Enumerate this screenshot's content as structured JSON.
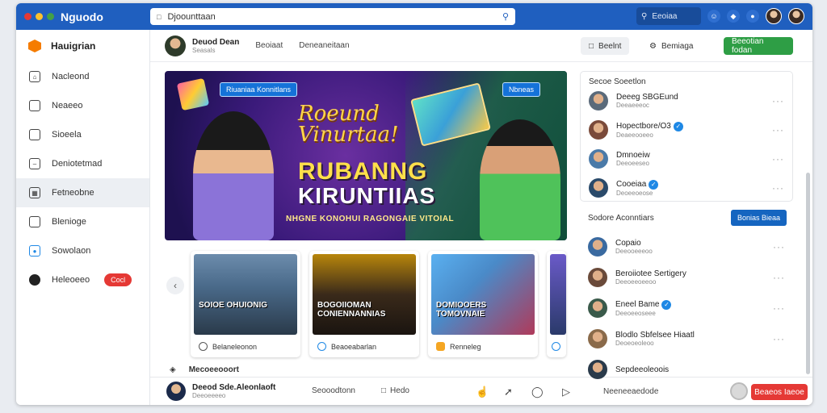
{
  "window": {
    "dots": [
      "#e53935",
      "#fbc02d",
      "#43a047"
    ],
    "brand": "Nguodo",
    "search_placeholder": "Djoounttaan"
  },
  "topbar": {
    "search_label": "Eeoiaa",
    "accent": "#1f5fbf"
  },
  "sidebar": {
    "brand": "Hauigrian",
    "items": [
      {
        "label": "Nacleond",
        "icon": "home-icon"
      },
      {
        "label": "Neaeeo",
        "icon": "bookmark-icon"
      },
      {
        "label": "Sioeela",
        "icon": "square-icon"
      },
      {
        "label": "Deniotetmad",
        "icon": "document-icon"
      },
      {
        "label": "Fetneobne",
        "icon": "grid-icon",
        "active": true
      },
      {
        "label": "Blenioge",
        "icon": "folder-icon"
      },
      {
        "label": "Sowolaon",
        "icon": "camera-icon"
      },
      {
        "label": "Heleoeeo",
        "icon": "user-icon",
        "badge": "Cocl"
      }
    ]
  },
  "header": {
    "user_name": "Deuod Dean",
    "user_sub": "Seasals",
    "tabs": [
      "Beoiaat",
      "Deneaneitaan"
    ],
    "buttons": {
      "feedback": "Beelnt",
      "settings": "Bemiaga",
      "primary": "Beeotian fodan"
    }
  },
  "banner": {
    "tag_left": "Riuaniaa Konnitlans",
    "tag_right": "Nbneas",
    "script": "Roeund Vinurtaa!",
    "title1": "RUBANNG",
    "title2": "KIRUNTIIAS",
    "subtitle": "NHGNE KONOHUI RAGONGAIE VITOIAL"
  },
  "carousel": {
    "cards": [
      {
        "caption": "SOIOE OHUIONIG",
        "footer": "Belaneleonon",
        "bg": "#4a6a8a"
      },
      {
        "caption": "BOGOIIOMAN CONIENNANNIAS",
        "footer": "Beaoeabarlan",
        "bg": "#3a2a1a"
      },
      {
        "caption": "DOMIOOERS TOMOVNAIE",
        "footer": "Renneleg",
        "bg": "#4a8ac8"
      }
    ]
  },
  "section": {
    "label": "Mecoeeooort",
    "icon": "compass-icon"
  },
  "bottombar": {
    "user_name": "Deeod Sde.Aleonlaoft",
    "user_sub": "Deeoeeeeo",
    "tab": "Seooodtonn",
    "icon_label": "Hedo",
    "status": "Neeneeaedode",
    "button": "Beaeos Iaeoe"
  },
  "right_panel": {
    "title": "Secoe Soeetlon",
    "rows": [
      {
        "name": "Deeeg SBGEund",
        "sub": "Deeaeeeoc",
        "verified": false,
        "bg": "#5a6a7a"
      },
      {
        "name": "Hopectbore/O3",
        "sub": "Deaeeooeeo",
        "verified": true,
        "bg": "#7a4a3a"
      },
      {
        "name": "Dmnoeiw",
        "sub": "Deeoeeseo",
        "verified": false,
        "bg": "#4a7aa8"
      },
      {
        "name": "Cooeiaa",
        "sub": "Deoeeoeose",
        "verified": true,
        "bg": "#2a4a6a"
      }
    ]
  },
  "right_panel2": {
    "title": "Sodore Aconntiars",
    "button": "Bonias Bieaa",
    "rows": [
      {
        "name": "Copaio",
        "sub": "Deeooeeeoo",
        "verified": false,
        "bg": "#3a6aa0"
      },
      {
        "name": "Beroiiotee Sertigery",
        "sub": "Deeoeeoeeoo",
        "verified": false,
        "bg": "#6a4a3a"
      },
      {
        "name": "Eneel Bame",
        "sub": "Deeoeeoseee",
        "verified": true,
        "bg": "#3a5a4a"
      },
      {
        "name": "Blodlo Sbfelsee Hiaatl",
        "sub": "Deoeoeoleoo",
        "verified": false,
        "bg": "#8a6a4a"
      },
      {
        "name": "Sepdeeoleoois",
        "sub": "",
        "verified": false,
        "bg": "#2a3a4a"
      }
    ]
  }
}
